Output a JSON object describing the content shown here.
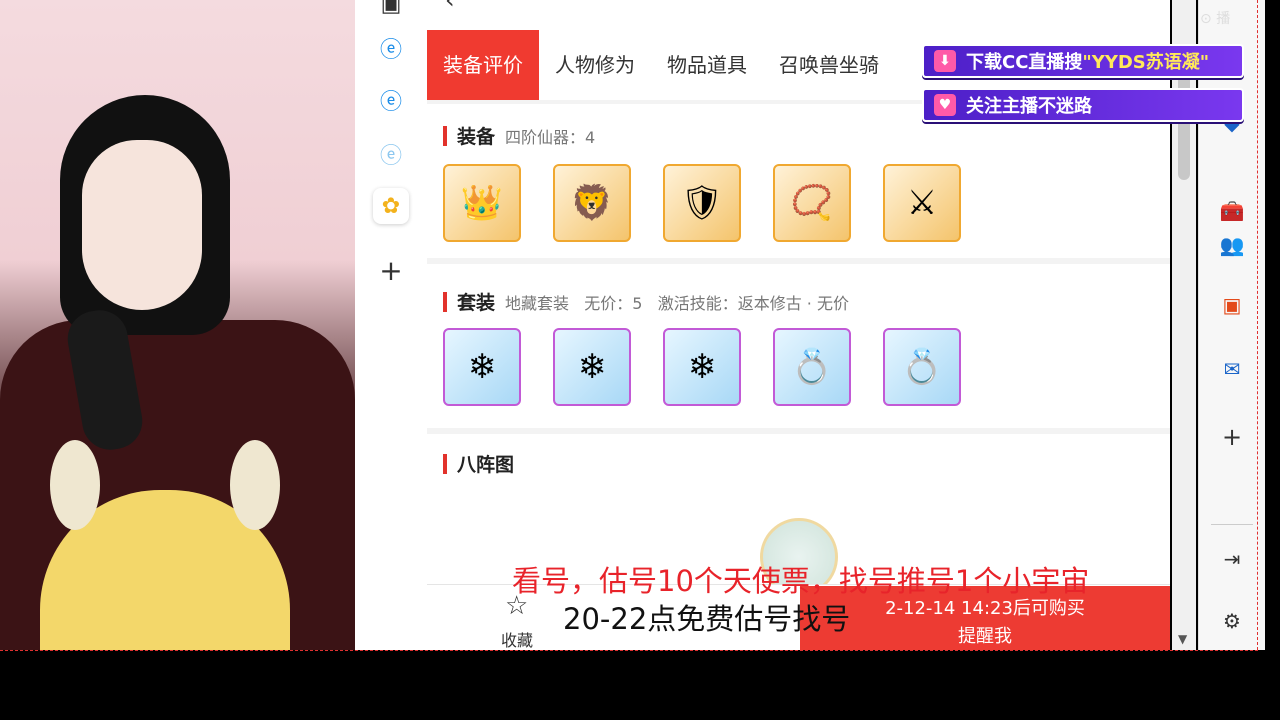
{
  "watermark": "播",
  "tabs": [
    "装备评价",
    "人物修为",
    "物品道具",
    "召唤兽坐骑"
  ],
  "sections": {
    "equip": {
      "name": "装备",
      "meta": "四阶仙器：4"
    },
    "suit": {
      "name": "套装",
      "meta": "地藏套装   无价：5   激活技能：返本修古 · 无价"
    },
    "formation": {
      "name": "八阵图"
    }
  },
  "banners": {
    "download": {
      "prefix": "下载CC直播搜",
      "highlight": "\"YYDS苏语凝\""
    },
    "follow": "关注主播不迷路"
  },
  "bottom": {
    "favorite_label": "收藏",
    "buy_time": "2-12-14 14:23后可购买",
    "remind_label": "提醒我"
  },
  "subtitles": {
    "line1": "看号，估号10个天使票，找号推号1个小宇宙",
    "line2": "20-22点免费估号找号"
  },
  "icons": {
    "equip": [
      "gold-helmet-icon",
      "gold-mask-icon",
      "gold-armor-icon",
      "gold-necklace-icon",
      "blue-weapon-icon"
    ],
    "suit": [
      "ice-crown-icon",
      "ice-pendant-icon",
      "ice-robe-icon",
      "ice-ring-icon",
      "ice-ring-2-icon"
    ]
  },
  "colors": {
    "accent": "#f03a30",
    "banner": "#5a28d8",
    "subtitle": "#e8232a"
  }
}
